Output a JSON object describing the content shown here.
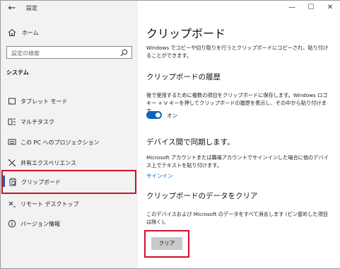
{
  "window": {
    "title": "設定",
    "back_icon": "arrow-left-icon",
    "controls": {
      "minimize": "—",
      "maximize": "☐",
      "close": "✕"
    }
  },
  "sidebar": {
    "home_label": "ホーム",
    "search_placeholder": "設定の検索",
    "section_label": "システム",
    "items": [
      {
        "label": "タブレット モード",
        "icon": "tablet-icon"
      },
      {
        "label": "マルチタスク",
        "icon": "multitask-icon"
      },
      {
        "label": "この PC へのプロジェクション",
        "icon": "projection-icon"
      },
      {
        "label": "共有エクスペリエンス",
        "icon": "shared-experience-icon"
      },
      {
        "label": "クリップボード",
        "icon": "clipboard-icon",
        "selected": true
      },
      {
        "label": "リモート デスクトップ",
        "icon": "remote-desktop-icon"
      },
      {
        "label": "バージョン情報",
        "icon": "info-icon"
      }
    ]
  },
  "main": {
    "title": "クリップボード",
    "intro": "Windows でコピーや切り取りを行うとクリップボードにコピーされ、貼り付けることができます。",
    "history": {
      "heading": "クリップボードの履歴",
      "desc": "後で使用するために複数の項目をクリップボードに保存します。Windows ロゴキー + V キーを押してクリップボードの履歴を表示し、その中から貼り付けます。",
      "toggle_label": "オン",
      "toggle_state": "on"
    },
    "sync": {
      "heading": "デバイス間で同期します。",
      "desc": "Microsoft アカウントまたは職場アカウントでサインインした場合に他のデバイス上でテキストを貼り付けます。",
      "signin_link": "サインイン"
    },
    "clear": {
      "heading": "クリップボードのデータをクリア",
      "desc": "このデバイスおよび Microsoft のデータをすべて消去します (ピン留めした項目は除く)。",
      "button_label": "クリア"
    }
  },
  "colors": {
    "accent": "#1063b8",
    "highlight_border": "#d0102b",
    "link": "#0064c8",
    "sidebar_bg": "#f2f2f2"
  }
}
